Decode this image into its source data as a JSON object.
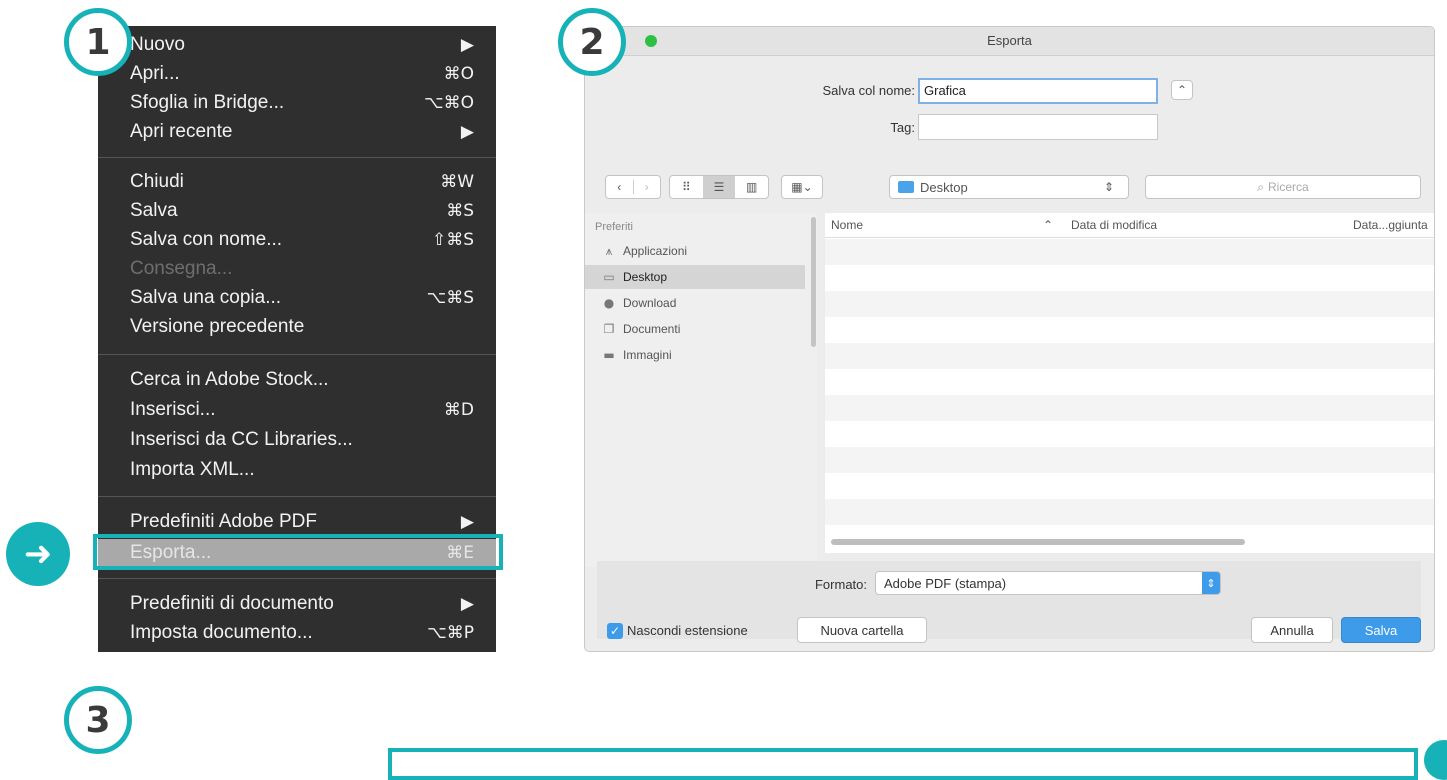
{
  "badges": {
    "step1": "1",
    "step2": "2",
    "step3": "3",
    "arrow": "➜"
  },
  "menu": {
    "items": [
      {
        "label": "Nuovo",
        "shortcut": "▶"
      },
      {
        "label": "Apri...",
        "shortcut": "⌘O"
      },
      {
        "label": "Sfoglia in Bridge...",
        "shortcut": "⌥⌘O"
      },
      {
        "label": "Apri recente",
        "shortcut": "▶"
      },
      {
        "label": "Chiudi",
        "shortcut": "⌘W"
      },
      {
        "label": "Salva",
        "shortcut": "⌘S"
      },
      {
        "label": "Salva con nome...",
        "shortcut": "⇧⌘S"
      },
      {
        "label": "Consegna...",
        "shortcut": ""
      },
      {
        "label": "Salva una copia...",
        "shortcut": "⌥⌘S"
      },
      {
        "label": "Versione precedente",
        "shortcut": ""
      },
      {
        "label": "Cerca in Adobe Stock...",
        "shortcut": ""
      },
      {
        "label": "Inserisci...",
        "shortcut": "⌘D"
      },
      {
        "label": "Inserisci da CC Libraries...",
        "shortcut": ""
      },
      {
        "label": "Importa XML...",
        "shortcut": ""
      },
      {
        "label": "Predefiniti Adobe PDF",
        "shortcut": "▶"
      },
      {
        "label": "Esporta...",
        "shortcut": "⌘E"
      },
      {
        "label": "Predefiniti di documento",
        "shortcut": "▶"
      },
      {
        "label": "Imposta documento...",
        "shortcut": "⌥⌘P"
      }
    ]
  },
  "dialog": {
    "title": "Esporta",
    "save_as_label": "Salva col nome:",
    "save_as_value": "Grafica",
    "tag_label": "Tag:",
    "tag_value": "",
    "location": "Desktop",
    "search_placeholder": "Ricerca",
    "sidebar": {
      "header": "Preferiti",
      "items": [
        "Applicazioni",
        "Desktop",
        "Download",
        "Documenti",
        "Immagini"
      ]
    },
    "columns": {
      "name": "Nome",
      "modified": "Data di modifica",
      "added": "Data...ggiunta"
    },
    "format_label": "Formato:",
    "format_value": "Adobe PDF (stampa)",
    "hide_extension_label": "Nascondi estensione",
    "hide_extension_checked": true,
    "new_folder_label": "Nuova cartella",
    "cancel_label": "Annulla",
    "save_label": "Salva"
  },
  "colors": {
    "accent": "#16b2b8",
    "menu_bg": "#2f2f2f",
    "primary_button": "#3d9be9"
  }
}
